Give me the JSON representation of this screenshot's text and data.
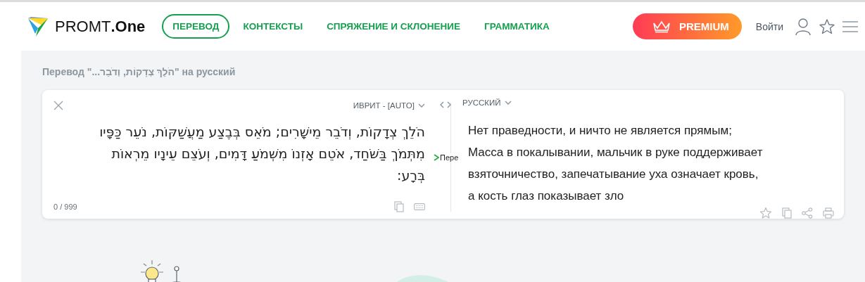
{
  "header": {
    "logo": {
      "name": "PROMT",
      "suffix": ".One"
    },
    "nav": [
      {
        "label": "ПЕРЕВОД",
        "selected": true
      },
      {
        "label": "КОНТЕКСТЫ",
        "selected": false
      },
      {
        "label": "СПРЯЖЕНИЕ И СКЛОНЕНИЕ",
        "selected": false
      },
      {
        "label": "ГРАММАТИКА",
        "selected": false
      }
    ],
    "premium": "PREMIUM",
    "login": "Войти"
  },
  "page_title": "Перевод \"...הֹלֵךְ צְדָקוֹת, וְדֹבֵר\" на русский",
  "translator": {
    "source_lang": "ИВРИТ - [AUTO]",
    "target_lang": "РУССКИЙ",
    "source_text": "הֹלֵךְ צְדָקוֹת, וְדֹבֵר מֵישָׁרִים; מֹאֵס בְּבֶצַע מַעֲשַׁקּוֹת, נֹעֵר כַּפָּיו מִתְּמֹךְ בַּשֹּׁחַד, אֹטֵם אָזְנוֹ מִשְּׁמֹעַ דָּמִים, וְעֹצֵם עֵינָיו מֵרְאוֹת בְּרָע:",
    "counter": "0 / 999",
    "overlay_label": "Пере",
    "target_lines": [
      "Нет праведности, и ничто не является прямым;",
      "Масса в покалывании, мальчик в руке поддерживает",
      "взяточничество, запечатывание уха означает кровь,",
      "а кость глаз показывает зло"
    ]
  }
}
